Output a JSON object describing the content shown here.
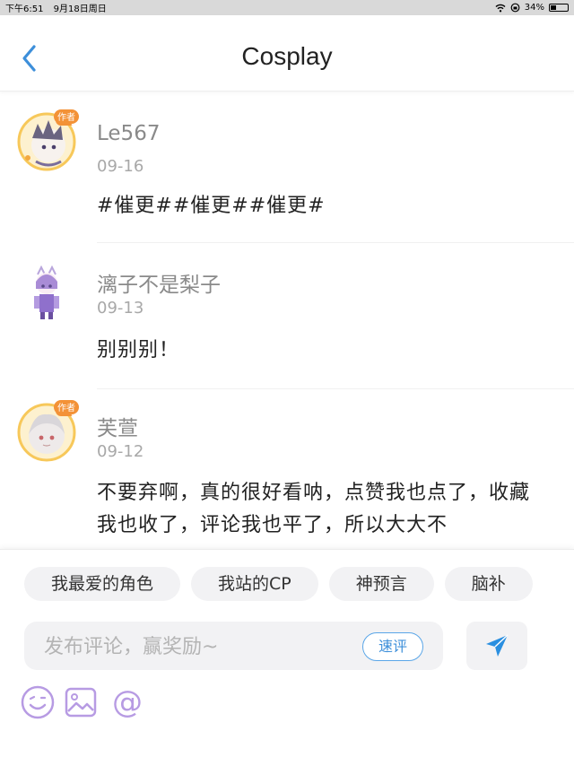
{
  "status_bar": {
    "time": "下午6:51",
    "date": "9月18日周日",
    "battery": "34%",
    "battery_level": 0.34
  },
  "nav": {
    "title": "Cosplay",
    "back_icon": "chevron-left-icon"
  },
  "comments": [
    {
      "username": "Le567",
      "date": "09-16",
      "content": "#催更##催更##催更#",
      "badge": "作者"
    },
    {
      "username": "漓子不是梨子",
      "date": "09-13",
      "content": "别别别！"
    },
    {
      "username": "芙萱",
      "date": "09-12",
      "content": "不要弃啊，真的很好看呐，点赞我也点了，收藏我也收了，评论我也平了，所以大大不",
      "badge": "作者"
    }
  ],
  "chips": [
    "我最爱的角色",
    "我站的CP",
    "神预言",
    "脑补"
  ],
  "input": {
    "placeholder": "发布评论，赢奖励~",
    "quick_label": "速评"
  },
  "tools": [
    "emoji-icon",
    "image-icon",
    "mention-icon"
  ],
  "colors": {
    "accent": "#3d8fda",
    "tool_purple": "#b79be3",
    "username": "#8a8a8a"
  }
}
